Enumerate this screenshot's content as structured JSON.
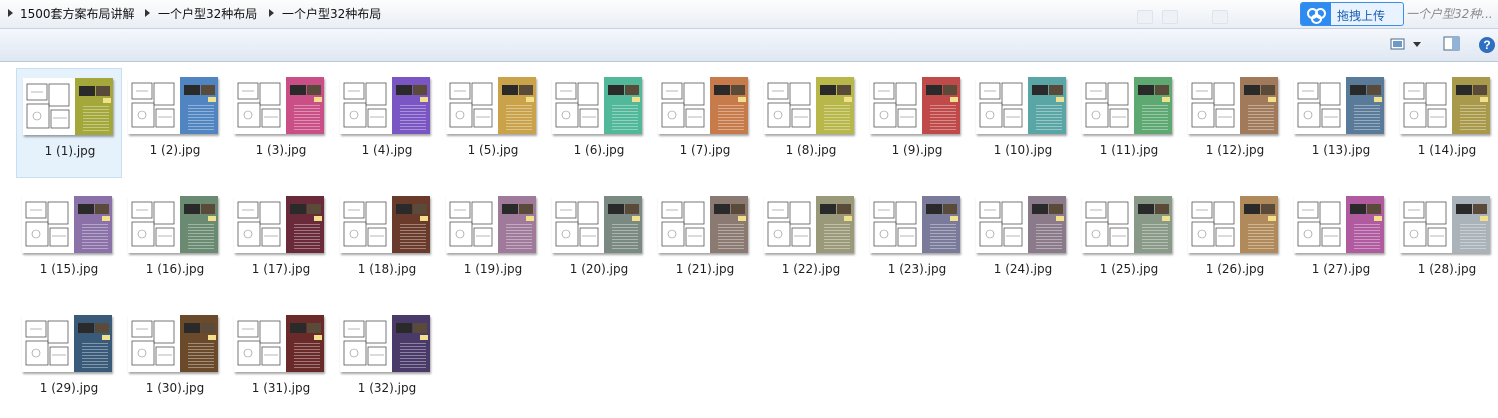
{
  "breadcrumb": [
    "1500套方案布局讲解",
    "一个户型32种布局",
    "一个户型32种布局"
  ],
  "upload_button": {
    "label": "拖拽上传",
    "brand_color": "#2e8cf0"
  },
  "search": {
    "placeholder": "一个户型32种..."
  },
  "toolbar": {
    "view_icon": "view-thumbnail-icon",
    "preview_icon": "preview-pane-icon",
    "help_icon": "help-icon",
    "help_label": "?"
  },
  "files": [
    {
      "name": "1 (1).jpg",
      "color": "#a4a83a"
    },
    {
      "name": "1 (2).jpg",
      "color": "#5185c2"
    },
    {
      "name": "1 (3).jpg",
      "color": "#c94f86"
    },
    {
      "name": "1 (4).jpg",
      "color": "#7a55c4"
    },
    {
      "name": "1 (5).jpg",
      "color": "#c9a24a"
    },
    {
      "name": "1 (6).jpg",
      "color": "#52b89a"
    },
    {
      "name": "1 (7).jpg",
      "color": "#c77a4a"
    },
    {
      "name": "1 (8).jpg",
      "color": "#b8b84a"
    },
    {
      "name": "1 (9).jpg",
      "color": "#c04a4a"
    },
    {
      "name": "1 (10).jpg",
      "color": "#5aa6a6"
    },
    {
      "name": "1 (11).jpg",
      "color": "#5ea872"
    },
    {
      "name": "1 (12).jpg",
      "color": "#a07a5a"
    },
    {
      "name": "1 (13).jpg",
      "color": "#5a7a9a"
    },
    {
      "name": "1 (14).jpg",
      "color": "#a89a4a"
    },
    {
      "name": "1 (15).jpg",
      "color": "#8a72a8"
    },
    {
      "name": "1 (16).jpg",
      "color": "#6a8a72"
    },
    {
      "name": "1 (17).jpg",
      "color": "#6a2a3a"
    },
    {
      "name": "1 (18).jpg",
      "color": "#6a3a2a"
    },
    {
      "name": "1 (19).jpg",
      "color": "#a07a9a"
    },
    {
      "name": "1 (20).jpg",
      "color": "#7a8a82"
    },
    {
      "name": "1 (21).jpg",
      "color": "#8a7a72"
    },
    {
      "name": "1 (22).jpg",
      "color": "#9a9a7a"
    },
    {
      "name": "1 (23).jpg",
      "color": "#7a7a9a"
    },
    {
      "name": "1 (24).jpg",
      "color": "#8a7a8a"
    },
    {
      "name": "1 (25).jpg",
      "color": "#8a9a88"
    },
    {
      "name": "1 (26).jpg",
      "color": "#b08a5a"
    },
    {
      "name": "1 (27).jpg",
      "color": "#b05aa0"
    },
    {
      "name": "1 (28).jpg",
      "color": "#aab2ba"
    },
    {
      "name": "1 (29).jpg",
      "color": "#3a5a7a"
    },
    {
      "name": "1 (30).jpg",
      "color": "#6a4a2a"
    },
    {
      "name": "1 (31).jpg",
      "color": "#6a2a2a"
    },
    {
      "name": "1 (32).jpg",
      "color": "#4a3a6a"
    }
  ],
  "selected_index": 0
}
